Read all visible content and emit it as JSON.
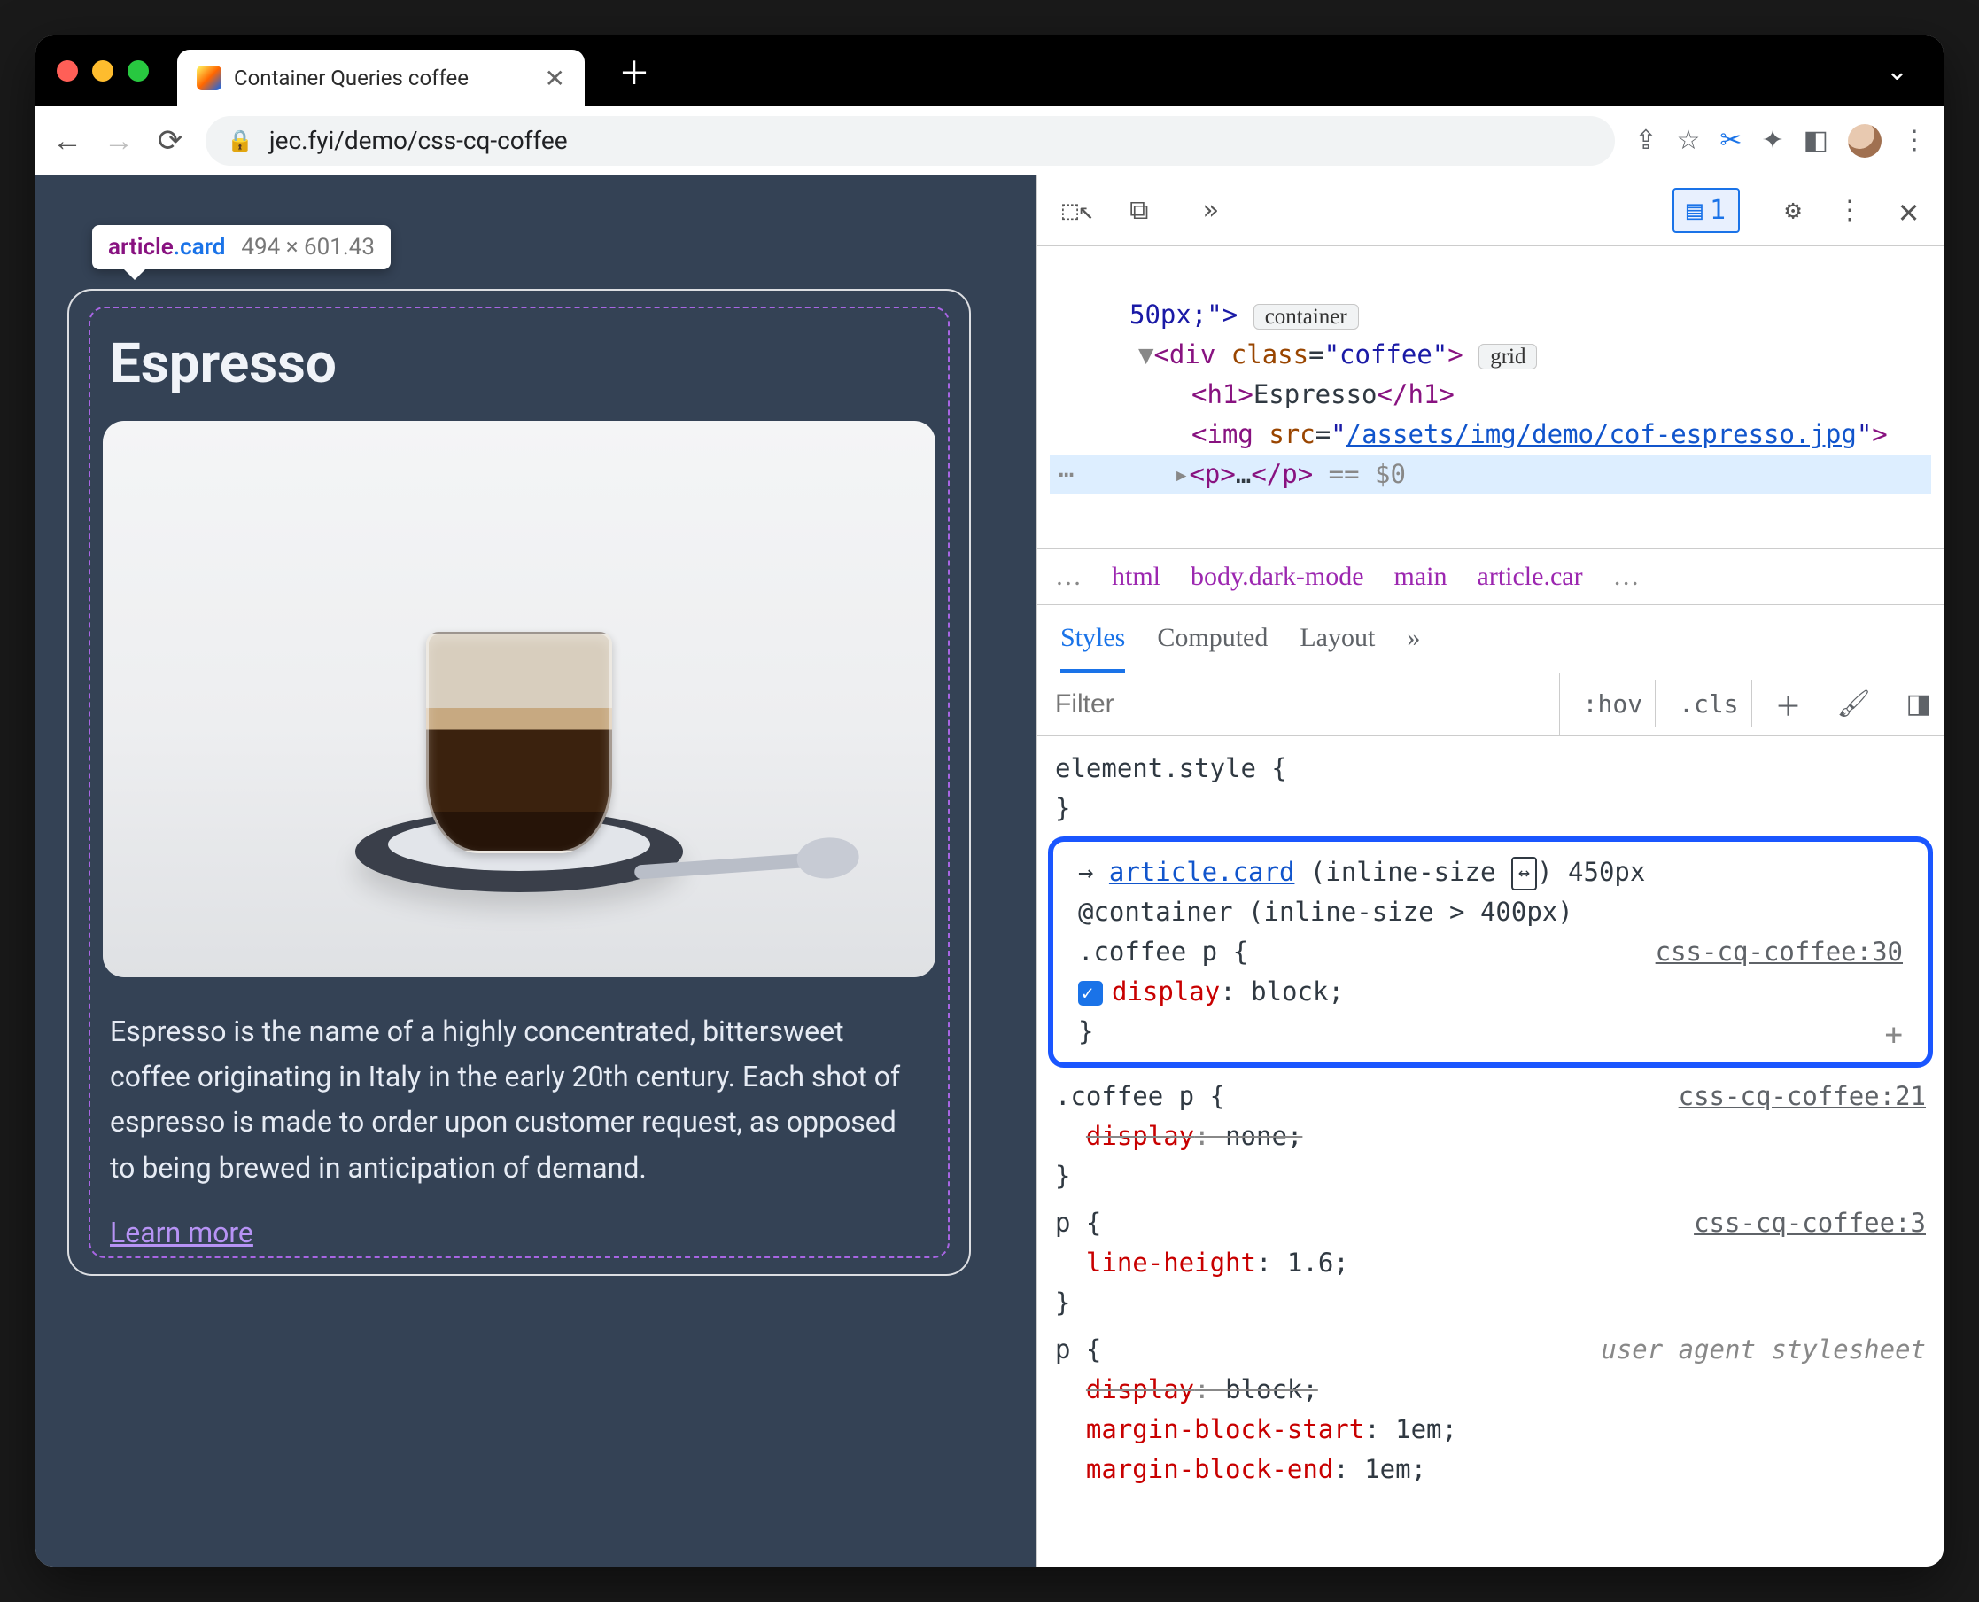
{
  "window": {
    "tab_title": "Container Queries coffee",
    "url_display": "jec.fyi/demo/css-cq-coffee"
  },
  "tooltip": {
    "selector_tag": "article",
    "selector_class": ".card",
    "dimensions": "494 × 601.43"
  },
  "page": {
    "heading": "Espresso",
    "paragraph": "Espresso is the name of a highly concentrated, bittersweet coffee originating in Italy in the early 20th century. Each shot of espresso is made to order upon customer request, as opposed to being brewed in anticipation of demand.",
    "learn_more": "Learn more"
  },
  "devtools": {
    "toolbar": {
      "badge_count": "1"
    },
    "elements": {
      "line0_pre": "50px;\">",
      "pill_container": "container",
      "line1_open": "<div class=\"coffee\">",
      "pill_grid": "grid",
      "line2": "<h1>Espresso</h1>",
      "line3_pre": "<img src=\"",
      "line3_link": "/assets/img/demo/cof-espresso.jpg",
      "line3_post": "\">",
      "line4_pre": "<p>",
      "line4_ell": "…",
      "line4_post": "</p>",
      "line4_eq": " == $0"
    },
    "breadcrumb": {
      "items": [
        "html",
        "body.dark-mode",
        "main",
        "article.car"
      ]
    },
    "tabs": {
      "styles": "Styles",
      "computed": "Computed",
      "layout": "Layout"
    },
    "filter": {
      "placeholder": "Filter",
      "hov": ":hov",
      "cls": ".cls"
    },
    "styles": {
      "element_style": "element.style {",
      "close": "}",
      "hl": {
        "arrow": "→ ",
        "link": "article.card",
        "paren_pre": " (inline-size ",
        "paren_post": ") 450px",
        "at": "@container (inline-size > 400px)",
        "sel": ".coffee p {",
        "src": "css-cq-coffee:30",
        "prop": "display",
        "val": "block;"
      },
      "rule2": {
        "sel": ".coffee p {",
        "src": "css-cq-coffee:21",
        "prop": "display",
        "val": "none;"
      },
      "rule3": {
        "sel": "p {",
        "src": "css-cq-coffee:3",
        "prop": "line-height",
        "val": "1.6;"
      },
      "rule4": {
        "sel": "p {",
        "src": "user agent stylesheet",
        "p1": "display",
        "v1": "block;",
        "p2": "margin-block-start",
        "v2": "1em;",
        "p3": "margin-block-end",
        "v3": "1em;"
      }
    }
  }
}
